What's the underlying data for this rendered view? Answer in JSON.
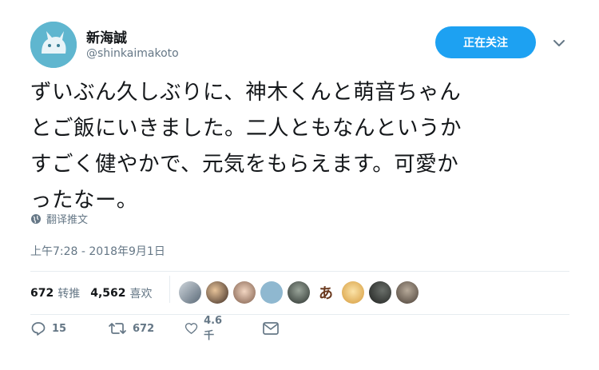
{
  "author": {
    "name": "新海誠",
    "handle": "@shinkaimakoto"
  },
  "follow_button": "正在关注",
  "tweet_lines": [
    "ずいぶん久しぶりに、神木くんと萌音ちゃん",
    "とご飯にいきました。二人ともなんというか",
    "すごく健やかで、元気をもらえます。可愛か",
    "ったなー。"
  ],
  "translate_label": "翻译推文",
  "timestamp": "上午7:28 - 2018年9月1日",
  "stats": {
    "retweets_count": "672",
    "retweets_label": "转推",
    "likes_count": "4,562",
    "likes_label": "喜欢"
  },
  "liker_glyphs": [
    "",
    "",
    "",
    "",
    "",
    "あ",
    "",
    "",
    ""
  ],
  "actions": {
    "reply_count": "15",
    "retweet_count": "672",
    "like_count": "4.6千"
  },
  "colors": {
    "accent": "#1da1f2",
    "text": "#14171a",
    "muted": "#657786",
    "divider": "#e6ecf0",
    "avatar_bg": "#5fb6cf"
  },
  "icons": {
    "translate": "globe-icon",
    "dropdown": "chevron-down-icon",
    "reply": "reply-icon",
    "retweet": "retweet-icon",
    "like": "heart-icon",
    "dm": "envelope-icon"
  }
}
